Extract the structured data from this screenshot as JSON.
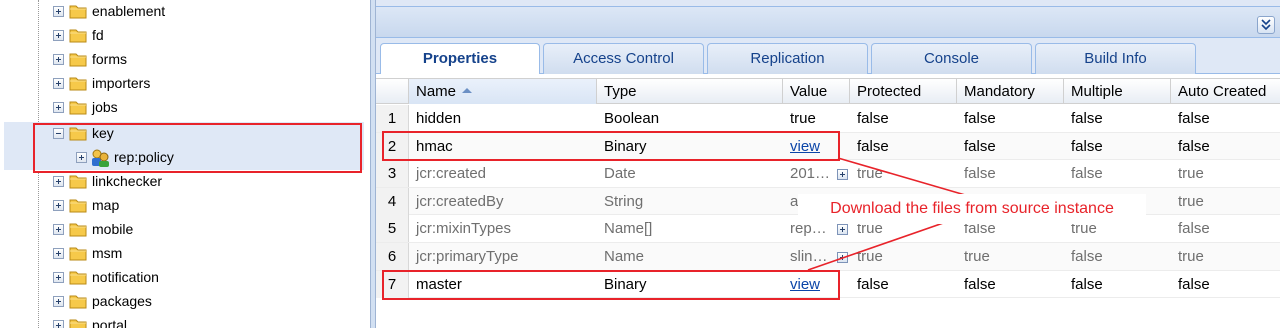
{
  "tree": {
    "items": [
      {
        "label": "enablement",
        "expander": "plus",
        "icon": "folder-icon"
      },
      {
        "label": "fd",
        "expander": "plus",
        "icon": "folder-icon"
      },
      {
        "label": "forms",
        "expander": "plus",
        "icon": "folder-icon"
      },
      {
        "label": "importers",
        "expander": "plus",
        "icon": "folder-icon"
      },
      {
        "label": "jobs",
        "expander": "plus",
        "icon": "folder-icon"
      },
      {
        "label": "key",
        "expander": "minus",
        "icon": "folder-icon",
        "selected": true
      },
      {
        "label": "rep:policy",
        "expander": "plus",
        "icon": "policy-icon",
        "child": true
      },
      {
        "label": "linkchecker",
        "expander": "plus",
        "icon": "folder-icon"
      },
      {
        "label": "map",
        "expander": "plus",
        "icon": "folder-icon"
      },
      {
        "label": "mobile",
        "expander": "plus",
        "icon": "folder-icon"
      },
      {
        "label": "msm",
        "expander": "plus",
        "icon": "folder-icon"
      },
      {
        "label": "notification",
        "expander": "plus",
        "icon": "folder-icon"
      },
      {
        "label": "packages",
        "expander": "plus",
        "icon": "folder-icon"
      },
      {
        "label": "portal",
        "expander": "plus",
        "icon": "folder-icon"
      }
    ]
  },
  "tabs": [
    {
      "label": "Properties",
      "active": true
    },
    {
      "label": "Access Control"
    },
    {
      "label": "Replication"
    },
    {
      "label": "Console"
    },
    {
      "label": "Build Info"
    }
  ],
  "grid": {
    "columns": [
      "Name",
      "Type",
      "Value",
      "Protected",
      "Mandatory",
      "Multiple",
      "Auto Created"
    ],
    "sorted_column": "Name",
    "rows": [
      {
        "num": "1",
        "name": "hidden",
        "type": "Boolean",
        "value": "true",
        "protected": "false",
        "mandatory": "false",
        "multiple": "false",
        "auto_created": "false"
      },
      {
        "num": "2",
        "name": "hmac",
        "type": "Binary",
        "value": "view",
        "protected": "false",
        "mandatory": "false",
        "multiple": "false",
        "auto_created": "false"
      },
      {
        "num": "3",
        "name": "jcr:created",
        "type": "Date",
        "value": "201…",
        "protected": "true",
        "mandatory": "false",
        "multiple": "false",
        "auto_created": "true"
      },
      {
        "num": "4",
        "name": "jcr:createdBy",
        "type": "String",
        "value": "a",
        "protected": "",
        "mandatory": "",
        "multiple": "",
        "auto_created": "true"
      },
      {
        "num": "5",
        "name": "jcr:mixinTypes",
        "type": "Name[]",
        "value": "rep…",
        "protected": "true",
        "mandatory": "false",
        "multiple": "true",
        "auto_created": "false"
      },
      {
        "num": "6",
        "name": "jcr:primaryType",
        "type": "Name",
        "value": "slin…",
        "protected": "true",
        "mandatory": "true",
        "multiple": "false",
        "auto_created": "true"
      },
      {
        "num": "7",
        "name": "master",
        "type": "Binary",
        "value": "view",
        "protected": "false",
        "mandatory": "false",
        "multiple": "false",
        "auto_created": "false"
      }
    ]
  },
  "annotation": {
    "text": "Download the files from source instance",
    "color": "#e8232a"
  },
  "colors": {
    "panel_bg": "#dfe8f6",
    "tab_text": "#15428b",
    "link": "#0b45a8"
  }
}
